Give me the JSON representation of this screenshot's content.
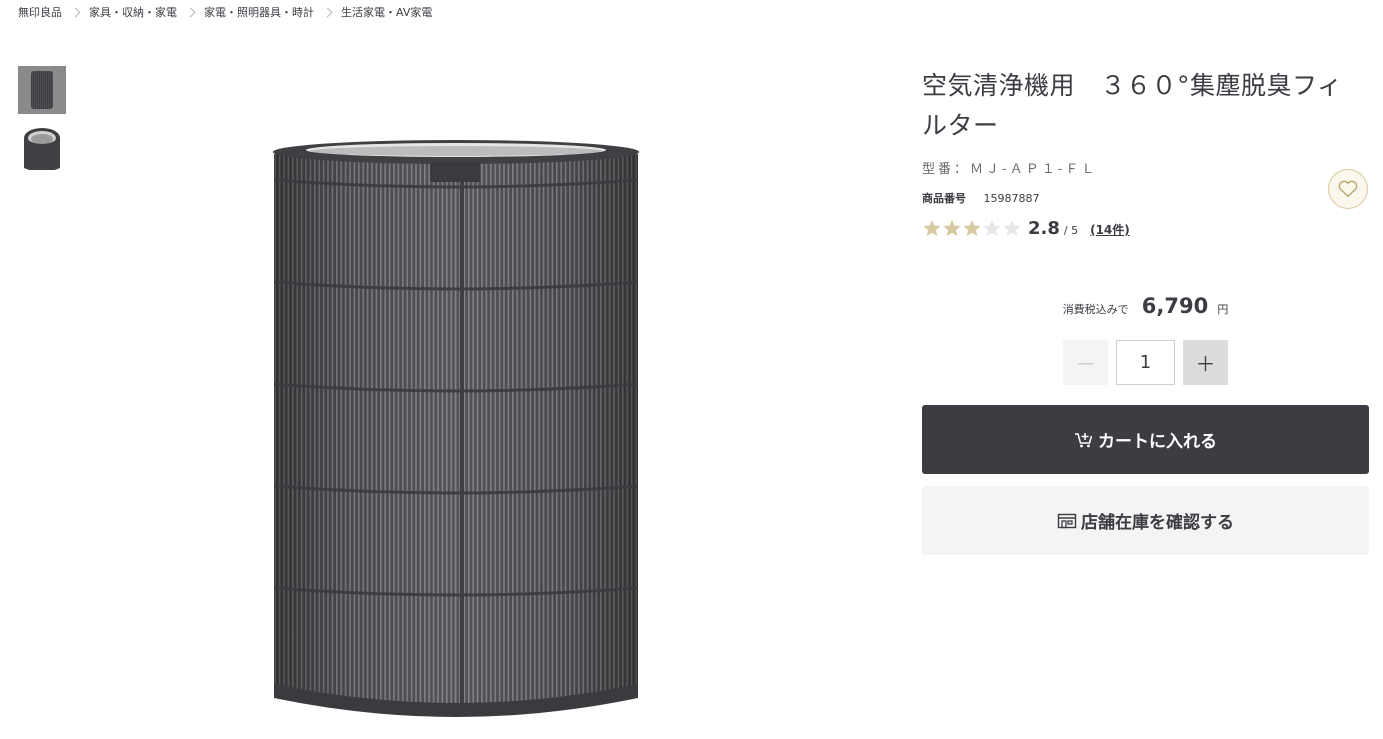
{
  "breadcrumb": [
    "無印良品",
    "家具・収納・家電",
    "家電・照明器具・時計",
    "生活家電・AV家電"
  ],
  "product": {
    "title": "空気清浄機用　３６０°集塵脱臭フィルター",
    "model": "型番：ＭＪ‐ＡＰ１‐ＦＬ",
    "product_no_label": "商品番号",
    "product_no": "15987887",
    "rating": {
      "score": "2.8",
      "out_of": "/ 5",
      "count": "(14件)",
      "stars_filled": 3,
      "stars_total": 5
    },
    "price": {
      "tax_label": "消費税込みで",
      "amount": "6,790",
      "currency": "円"
    },
    "quantity": {
      "value": "1",
      "minus": "－",
      "plus": "＋"
    },
    "buttons": {
      "cart": "カートに入れる",
      "store_stock": "店舗在庫を確認する"
    }
  },
  "icons": {
    "favorite": "heart-icon",
    "cart": "cart-plus-icon",
    "store": "store-icon"
  },
  "colors": {
    "primary_dark": "#3c3c43",
    "star_filled": "#d8c9a0",
    "star_empty": "#e8e8e8",
    "fav_bg": "#fbf7ec"
  }
}
